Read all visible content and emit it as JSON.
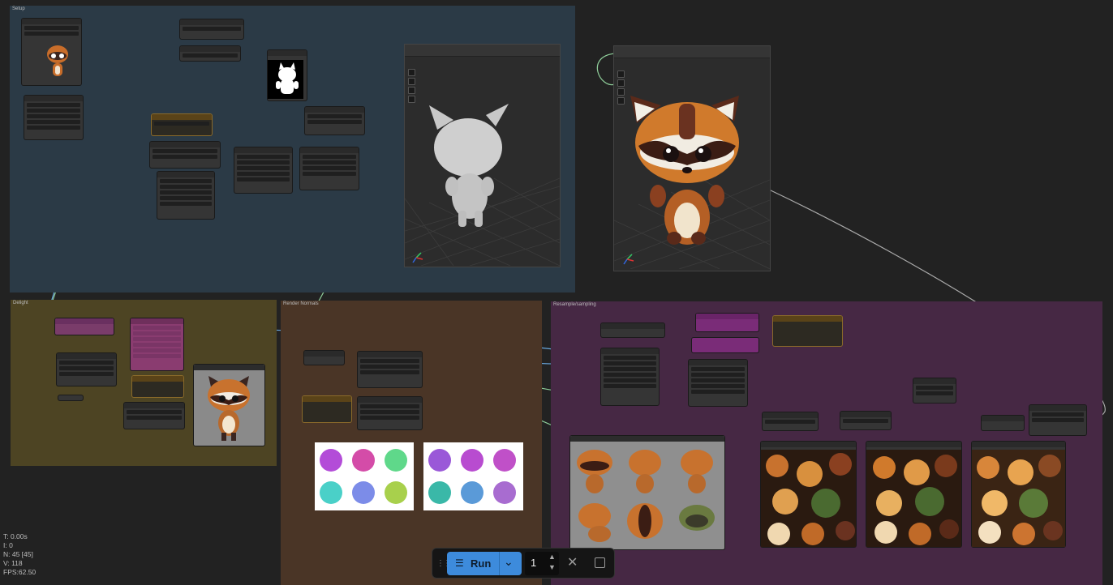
{
  "groups": {
    "setup": {
      "title": "Setup"
    },
    "delight": {
      "title": "Delight"
    },
    "render_normals": {
      "title": "Render Normals"
    },
    "resample": {
      "title": "Resample/sampling"
    }
  },
  "stats": {
    "t": "T: 0.00s",
    "i": "I: 0",
    "n": "N: 45 [45]",
    "v": "V: 118",
    "fps": "FPS:62.50"
  },
  "toolbar": {
    "drag_icon": "drag-handle-icon",
    "run_label": "Run",
    "queue_count": "1"
  },
  "colors": {
    "canvas": "#222222",
    "setup_group": "#2b3a46",
    "delight_group": "#4d4423",
    "render_group": "#4a3526",
    "resample_group": "#462844",
    "run_button": "#3d8bdc",
    "link_blue": "#6aa9e0",
    "link_green": "#8fce9a"
  }
}
